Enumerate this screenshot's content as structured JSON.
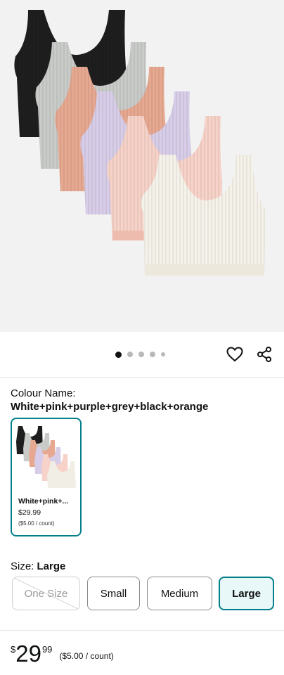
{
  "product_image": {
    "alt_icon": "ribbed-crop-tank-tops-image",
    "colors": [
      "#1e1e1e",
      "#c9cbc8",
      "#e6a890",
      "#d8cde8",
      "#f6d2c8",
      "#f5f2ea"
    ]
  },
  "carousel": {
    "dot_count": 5,
    "active_index": 0
  },
  "actions": {
    "wishlist_icon": "heart-icon",
    "share_icon": "share-icon"
  },
  "colour": {
    "label": "Colour Name:",
    "value": "White+pink+purple+grey+black+orange",
    "swatch": {
      "name": "White+pink+...",
      "price": "$29.99",
      "unit": "($5.00 / count)"
    }
  },
  "size": {
    "label": "Size: ",
    "value": "Large",
    "options": [
      {
        "label": "One Size",
        "state": "unavailable"
      },
      {
        "label": "Small",
        "state": "available"
      },
      {
        "label": "Medium",
        "state": "available"
      },
      {
        "label": "Large",
        "state": "selected"
      }
    ]
  },
  "price": {
    "currency": "$",
    "whole": "29",
    "fraction": "99",
    "unit": "($5.00 / count)"
  },
  "accent_color": "#037f8b"
}
